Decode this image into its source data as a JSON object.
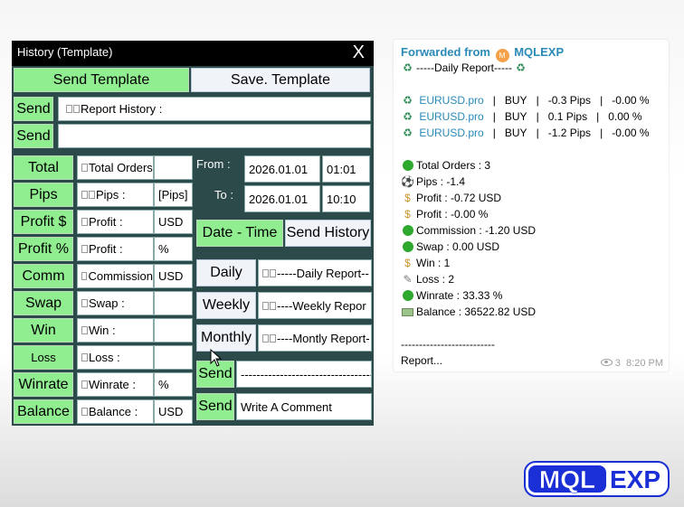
{
  "panel": {
    "title": "History (Template)",
    "close": "X",
    "send_template": "Send Template",
    "save_template": "Save. Template",
    "send1": "Send",
    "report_history_text": "Report History :",
    "send2": "Send",
    "left_buttons": [
      "Total",
      "Pips",
      "Profit $",
      "Profit %",
      "Comm",
      "Swap",
      "Win",
      "Loss",
      "Winrate",
      "Balance"
    ],
    "mid_labels": [
      "Total Orders",
      "Pips :",
      "Profit :",
      "Profit :",
      "Commission",
      "Swap :",
      "Win :",
      "Loss :",
      "Winrate :",
      "Balance :"
    ],
    "units": [
      "",
      "[Pips]",
      "USD",
      "%",
      "USD",
      "",
      "",
      "",
      "%",
      "USD"
    ],
    "from_label": "From :",
    "to_label": "To :",
    "from_date": "2026.01.01",
    "from_time": "01:01",
    "to_date": "2026.01.01",
    "to_time": "10:10",
    "date_time": "Date - Time",
    "send_history": "Send History",
    "daily": "Daily",
    "daily_text": "-----Daily Report--",
    "weekly": "Weekly",
    "weekly_text": "----Weekly Repor",
    "monthly": "Monthly",
    "monthly_text": "----Montly Report-",
    "send3": "Send",
    "dash_text": "-----------------------------------",
    "send4": "Send",
    "comment": "Write A Comment"
  },
  "chat": {
    "forwarded_from": "Forwarded from",
    "channel": "MQLEXP",
    "avatar_letter": "M",
    "report_title": "-----Daily Report-----",
    "trades": [
      {
        "symbol": "EURUSD.pro",
        "side": "BUY",
        "pips": "-0.3 Pips",
        "pct": "-0.00 %"
      },
      {
        "symbol": "EURUSD.pro",
        "side": "BUY",
        "pips": "0.1 Pips",
        "pct": "0.00 %"
      },
      {
        "symbol": "EURUSD.pro",
        "side": "BUY",
        "pips": "-1.2 Pips",
        "pct": "-0.00 %"
      }
    ],
    "sep": "|",
    "stats": [
      {
        "icon": "green-circle-icon",
        "text": "Total Orders : 3"
      },
      {
        "icon": "soccer-ball-icon",
        "text": "Pips : -1.4"
      },
      {
        "icon": "money-bag-icon",
        "text": "Profit : -0.72  USD"
      },
      {
        "icon": "money-bag-icon",
        "text": "Profit : -0.00  %"
      },
      {
        "icon": "green-circle-icon",
        "text": "Commission : -1.20  USD"
      },
      {
        "icon": "green-circle-icon",
        "text": "Swap : 0.00  USD"
      },
      {
        "icon": "money-bag-icon",
        "text": "Win : 1"
      },
      {
        "icon": "memo-icon",
        "text": "Loss : 2"
      },
      {
        "icon": "green-circle-icon",
        "text": "Winrate : 33.33  %"
      },
      {
        "icon": "dollar-banknote-icon",
        "text": "Balance : 36522.82  USD"
      }
    ],
    "footer_dashes": "--------------------------",
    "footer_text": "Report...",
    "views": "3",
    "time": "8:20 PM"
  },
  "logo": {
    "part1": "MQL",
    "part2": "EXP",
    "colors": {
      "blue": "#1a2fd6",
      "white": "#ffffff"
    }
  }
}
